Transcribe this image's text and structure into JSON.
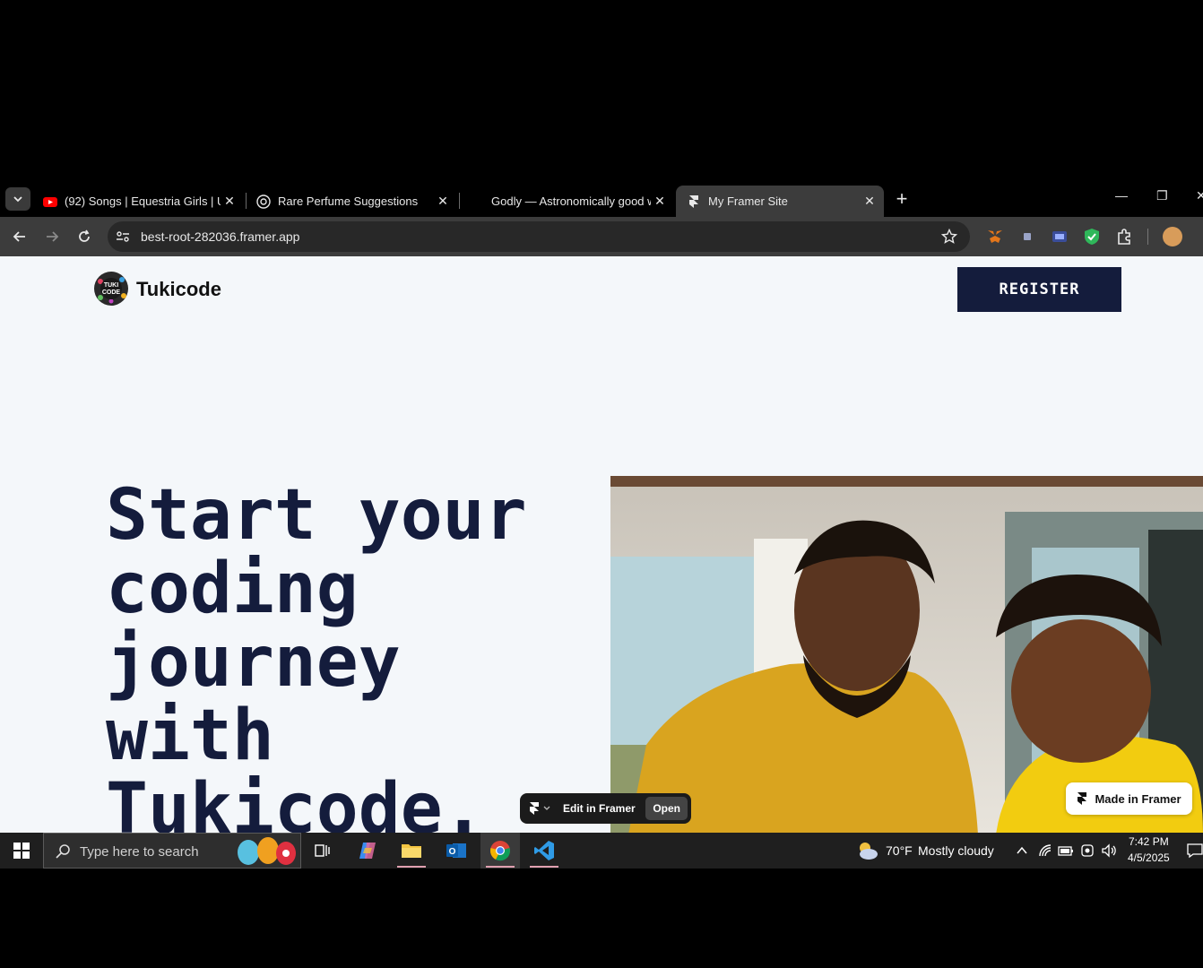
{
  "browser": {
    "tabs": [
      {
        "title": "(92) Songs | Equestria Girls | Unl",
        "icon": "youtube-icon"
      },
      {
        "title": "Rare Perfume Suggestions",
        "icon": "chatgpt-icon"
      },
      {
        "title": "Godly — Astronomically good w",
        "icon": "godly-icon"
      },
      {
        "title": "My Framer Site",
        "icon": "framer-icon",
        "active": true
      }
    ],
    "url": "best-root-282036.framer.app"
  },
  "page": {
    "brand": "Tukicode",
    "logo_text": "TUKI CODE",
    "register_label": "REGISTER",
    "headline": "Start your\ncoding\njourney\nwith\nTukicode.",
    "edit_in_framer_label": "Edit in Framer",
    "open_label": "Open",
    "made_in_framer_label": "Made in Framer"
  },
  "taskbar": {
    "search_placeholder": "Type here to search",
    "weather_temp": "70°F",
    "weather_desc": "Mostly cloudy",
    "time": "7:42 PM",
    "date": "4/5/2025"
  },
  "colors": {
    "page_bg": "#f4f7fa",
    "brand_navy": "#141c3c",
    "chrome_dark": "#3c3c3c"
  }
}
